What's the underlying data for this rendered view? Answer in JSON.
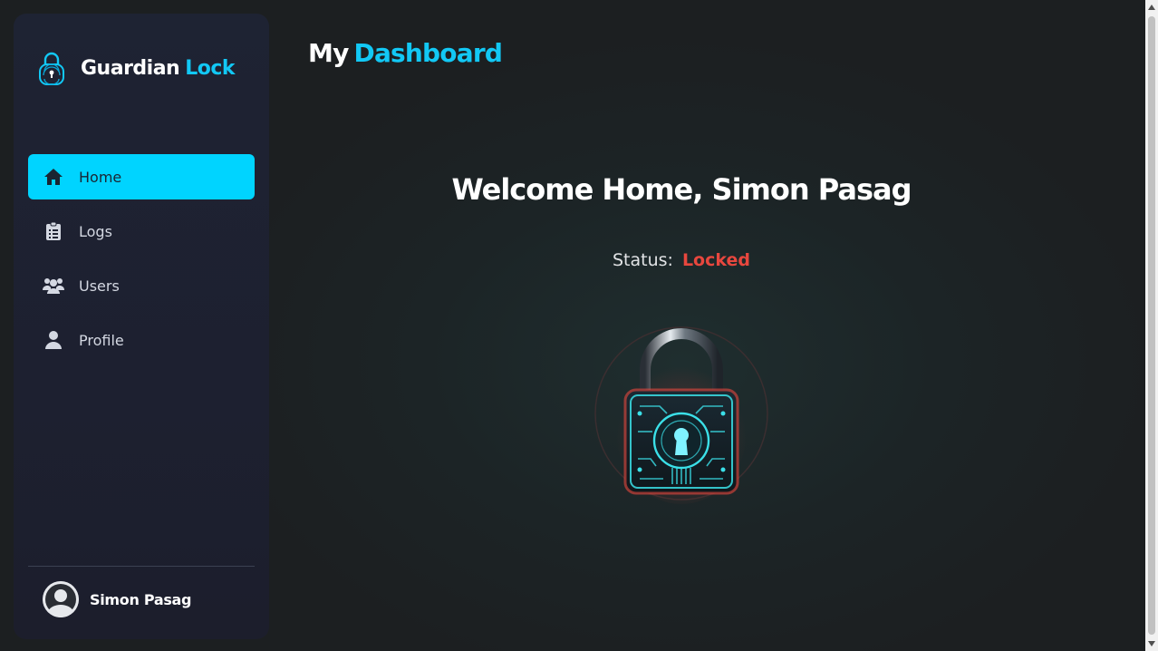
{
  "brand": {
    "name_part1": "Guardian",
    "name_part2": "Lock",
    "logo_icon": "fingerprint-lock-icon"
  },
  "nav": {
    "items": [
      {
        "label": "Home",
        "icon": "home-icon",
        "active": true
      },
      {
        "label": "Logs",
        "icon": "clipboard-icon",
        "active": false
      },
      {
        "label": "Users",
        "icon": "users-icon",
        "active": false
      },
      {
        "label": "Profile",
        "icon": "user-icon",
        "active": false
      }
    ]
  },
  "user": {
    "name": "Simon Pasag",
    "avatar_icon": "avatar-icon"
  },
  "header": {
    "title_part1": "My",
    "title_part2": "Dashboard"
  },
  "main": {
    "welcome": "Welcome Home, Simon Pasag",
    "status_label": "Status:",
    "status_value": "Locked",
    "lock_image": "padlock-locked-icon"
  },
  "colors": {
    "accent": "#12c8f5",
    "active_nav": "#00d4ff",
    "locked": "#e8473e",
    "sidebar": "#1e2333",
    "background": "#1c2224"
  }
}
